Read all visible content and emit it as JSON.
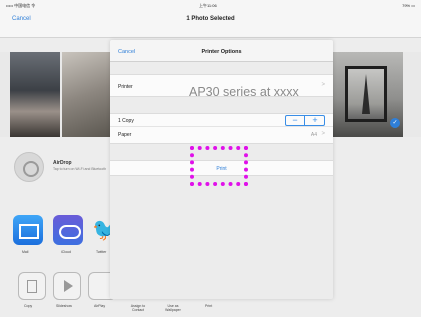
{
  "status_bar": {
    "carrier": "••••• 中国电信 令",
    "time": "上午11:06",
    "battery": "79% ▭"
  },
  "nav": {
    "cancel_label": "Cancel",
    "title": "1 Photo Selected"
  },
  "airdrop": {
    "title": "AirDrop",
    "subtitle": "Tap to turn on Wi-Fi and Bluetooth"
  },
  "apps": [
    {
      "label": "Mail",
      "icon": "mail-icon"
    },
    {
      "label": "iCloud",
      "icon": "icloud-icon"
    },
    {
      "label": "Twitter",
      "icon": "twitter-icon"
    }
  ],
  "actions": [
    {
      "label": "Copy",
      "icon": "copy-icon"
    },
    {
      "label": "Slideshow",
      "icon": "play-icon"
    },
    {
      "label": "AirPlay",
      "icon": "airplay-icon"
    },
    {
      "label": "Assign to Contact",
      "icon": "contact-icon"
    },
    {
      "label": "Use as Wallpaper",
      "icon": "wallpaper-icon"
    },
    {
      "label": "Print",
      "icon": "print-icon"
    }
  ],
  "printer_options": {
    "cancel_label": "Cancel",
    "title": "Printer Options",
    "printer_label": "Printer",
    "printer_value": "AP30 series at xxxx",
    "copies_label": "1 Copy",
    "stepper_minus": "−",
    "stepper_plus": "+",
    "paper_label": "Paper",
    "paper_value": "A4",
    "chevron": ">",
    "print_label": "Print"
  },
  "colors": {
    "accent": "#2f7fd8",
    "highlight": "#e011ea"
  }
}
